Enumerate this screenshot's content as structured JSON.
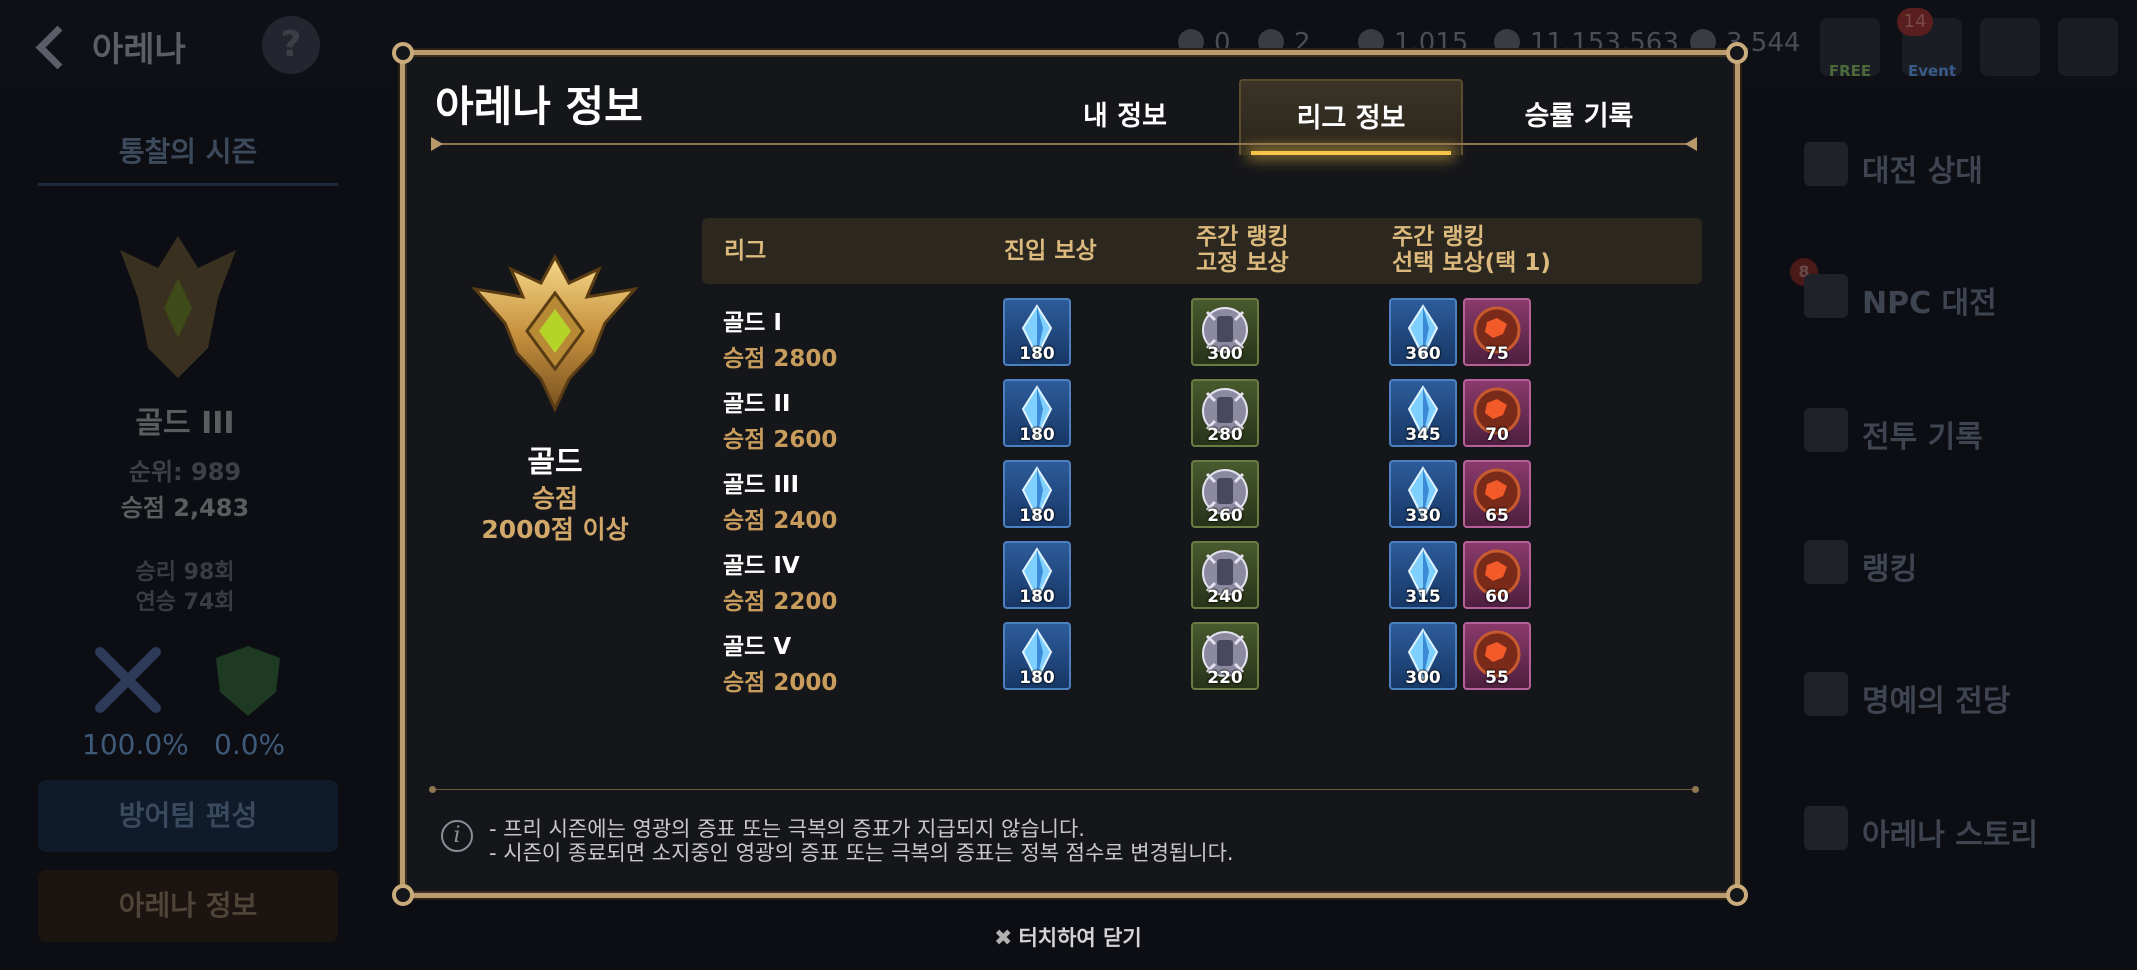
{
  "background": {
    "title": "아레나",
    "currencies": [
      "0",
      "2",
      "1,015",
      "11,153,563",
      "3,544"
    ],
    "top_icons": {
      "free_label": "FREE",
      "event_label": "Event",
      "mail_badge": "14"
    },
    "left": {
      "season_label": "통찰의 시즌",
      "rank_tier": "골드 III",
      "rank_position": "순위: 989",
      "score": "승점 2,483",
      "wins": "승리 98회",
      "streak": "연승 74회",
      "attack_pct": "100.0%",
      "defense_pct": "0.0%",
      "defense_team_button": "방어팀 편성",
      "arena_info_button": "아레나 정보"
    },
    "menu": {
      "npc_badge": "8",
      "items": [
        "대전 상대",
        "NPC 대전",
        "전투 기록",
        "랭킹",
        "명예의 전당",
        "아레나 스토리"
      ]
    }
  },
  "modal": {
    "title": "아레나 정보",
    "tabs": [
      "내 정보",
      "리그 정보",
      "승률 기록"
    ],
    "active_tab": "리그 정보",
    "league": {
      "name": "골드",
      "req_line1": "승점",
      "req_line2": "2000점 이상"
    },
    "columns": {
      "league": "리그",
      "entry": "진입 보상",
      "weekly_fixed_1": "주간 랭킹",
      "weekly_fixed_2": "고정 보상",
      "weekly_choice_1": "주간 랭킹",
      "weekly_choice_2": "선택 보상(택 1)"
    },
    "rows": [
      {
        "name": "골드 I",
        "score": "승점 2800",
        "entry": "180",
        "fixed": "300",
        "choice_a": "360",
        "choice_b": "75"
      },
      {
        "name": "골드 II",
        "score": "승점 2600",
        "entry": "180",
        "fixed": "280",
        "choice_a": "345",
        "choice_b": "70"
      },
      {
        "name": "골드 III",
        "score": "승점 2400",
        "entry": "180",
        "fixed": "260",
        "choice_a": "330",
        "choice_b": "65"
      },
      {
        "name": "골드 IV",
        "score": "승점 2200",
        "entry": "180",
        "fixed": "240",
        "choice_a": "315",
        "choice_b": "60"
      },
      {
        "name": "골드 V",
        "score": "승점 2000",
        "entry": "180",
        "fixed": "220",
        "choice_a": "300",
        "choice_b": "55"
      }
    ],
    "notices": [
      "- 프리 시즌에는 영광의 증표 또는 극복의 증표가 지급되지 않습니다.",
      "- 시즌이 종료되면 소지중인 영광의 증표 또는 극복의 증표는 정복 점수로 변경됩니다."
    ],
    "close_hint": "터치하여 닫기"
  },
  "colors": {
    "gold_accent": "#f6c448",
    "frame": "#b99b6e",
    "score_text": "#c79c5c",
    "header_text": "#dcb97c"
  }
}
